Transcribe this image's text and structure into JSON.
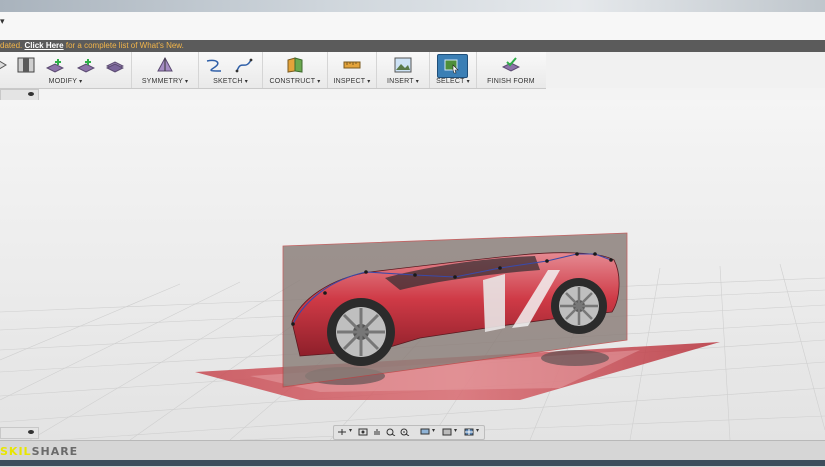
{
  "window": {
    "title_caret": "▾"
  },
  "notice": {
    "prefix": "dated.",
    "link": "Click Here",
    "suffix": " for a complete list of What's New."
  },
  "toolbar": {
    "groups": [
      {
        "label": "MODIFY",
        "icons": [
          "move-icon",
          "bridge-icon",
          "insert-face-icon",
          "fill-hole-icon",
          "thicken-icon"
        ]
      },
      {
        "label": "SYMMETRY",
        "icons": [
          "symmetry-icon"
        ]
      },
      {
        "label": "SKETCH",
        "icons": [
          "sketch-line-icon",
          "sketch-spline-icon"
        ]
      },
      {
        "label": "CONSTRUCT",
        "icons": [
          "construct-plane-icon"
        ]
      },
      {
        "label": "INSPECT",
        "icons": [
          "inspect-measure-icon"
        ]
      },
      {
        "label": "INSERT",
        "icons": [
          "insert-canvas-icon"
        ]
      },
      {
        "label": "SELECT",
        "icons": [
          "select-icon"
        ],
        "active": true
      },
      {
        "label": "FINISH FORM",
        "icons": [
          "finish-form-icon"
        ],
        "dropdown": false
      }
    ]
  },
  "navigation_bar": [
    "orbit-icon",
    "look-at-icon",
    "pan-icon",
    "zoom-window-icon",
    "zoom-icon",
    "display-icon",
    "grid-icon",
    "viewports-icon"
  ],
  "status": {
    "logo_a": "SKIL",
    "logo_b": "SHARE"
  },
  "colors": {
    "accent": "#f2b54a",
    "select_active": "#3b7fb5",
    "canvas_red": "#c8303c",
    "plane_grey": "#8a7d78"
  }
}
